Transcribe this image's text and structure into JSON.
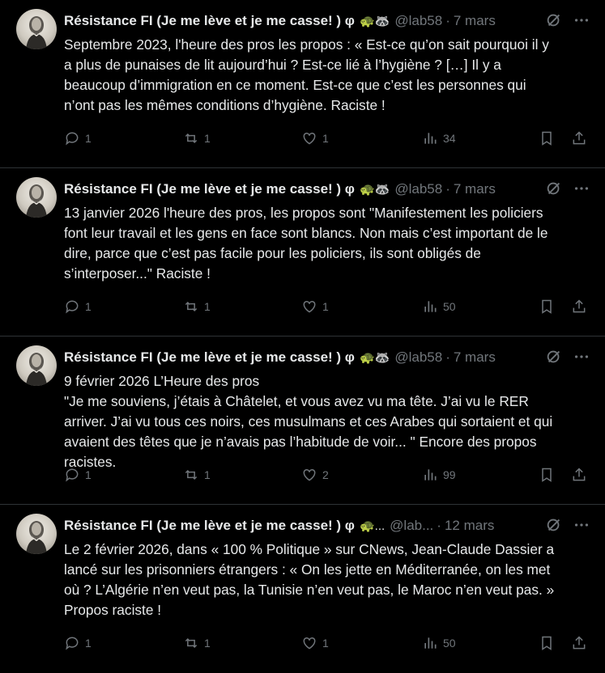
{
  "tweets": [
    {
      "name": "Résistance FI (Je me lève et je me casse! ) φ",
      "emoji": "🐢🦝",
      "handle": "@lab58",
      "time": "7 mars",
      "text": "Septembre 2023, l'heure des pros les propos : « Est-ce qu’on sait pourquoi il y\na plus de punaises de lit aujourd’hui ? Est-ce lié à l’hygiène ? […] Il y a\nbeaucoup d’immigration en ce moment. Est-ce que c’est les personnes qui\nn’ont pas les mêmes conditions d’hygiène. Raciste !",
      "replies": "1",
      "retweets": "1",
      "likes": "1",
      "views": "34"
    },
    {
      "name": "Résistance FI (Je me lève et je me casse! ) φ",
      "emoji": "🐢🦝",
      "handle": "@lab58",
      "time": "7 mars",
      "text": "13 janvier 2026 l'heure des pros, les propos sont \"Manifestement les policiers\nfont leur travail et les gens en face sont blancs. Non mais c’est important de le\ndire, parce que c’est pas facile pour les policiers, ils sont obligés de\ns’interposer...\" Raciste !",
      "replies": "1",
      "retweets": "1",
      "likes": "1",
      "views": "50"
    },
    {
      "name": "Résistance FI (Je me lève et je me casse! ) φ",
      "emoji": "🐢🦝",
      "handle": "@lab58",
      "time": "7 mars",
      "text": "9 février 2026 L’Heure des pros\n\"Je me souviens, j’étais à Châtelet, et vous avez vu ma tête. J’ai vu le RER\narriver. J’ai vu tous ces noirs, ces musulmans et ces Arabes qui sortaient et qui\navaient des têtes que je n’avais pas l’habitude de voir... \" Encore des propos\nracistes.",
      "replies": "1",
      "retweets": "1",
      "likes": "2",
      "views": "99"
    },
    {
      "name": "Résistance FI (Je me lève et je me casse! ) φ",
      "emoji": "🐢...",
      "handle": "@lab...",
      "time": "12 mars",
      "text": "Le 2 février 2026, dans « 100 % Politique » sur CNews, Jean-Claude Dassier a\nlancé sur les prisonniers étrangers : « On les jette en Méditerranée, on les met\noù ? L’Algérie n’en veut pas, la Tunisie n’en veut pas, le Maroc n’en veut pas. »\nPropos raciste !",
      "replies": "1",
      "retweets": "1",
      "likes": "1",
      "views": "50"
    }
  ],
  "separator": "·",
  "colors": {
    "background": "#000000",
    "text": "#e7e9ea",
    "muted": "#71767b",
    "divider": "#2f3336"
  },
  "icons": [
    "reply-icon",
    "retweet-icon",
    "like-icon",
    "views-icon",
    "bookmark-icon",
    "share-icon",
    "grok-icon",
    "more-icon"
  ]
}
